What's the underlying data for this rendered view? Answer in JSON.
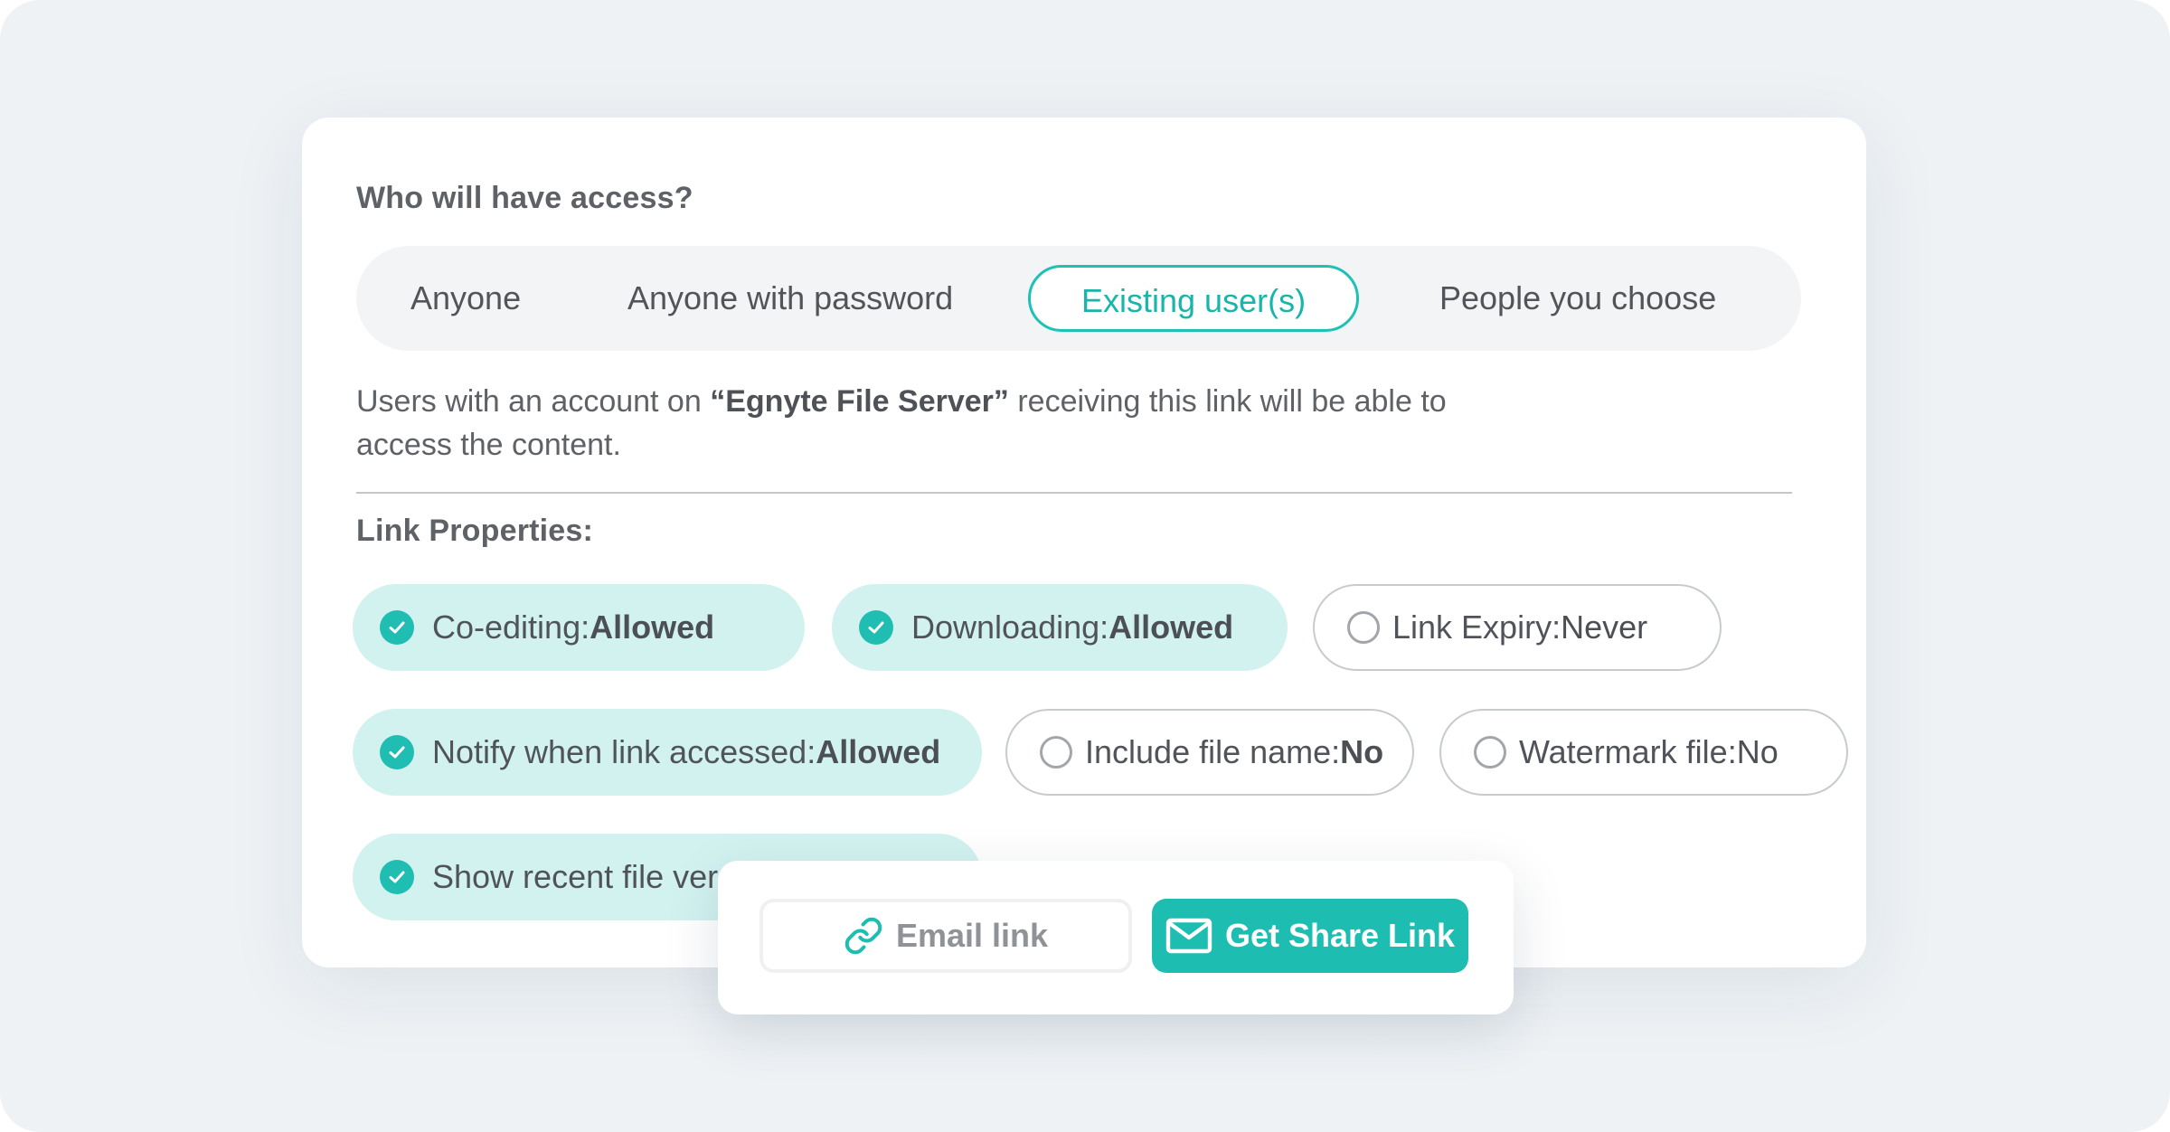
{
  "colors": {
    "accent": "#1ebdb2",
    "checked_pill_background": "#d2f2f0",
    "page_background": "#eef2f5"
  },
  "access": {
    "title": "Who will have access?",
    "options": [
      {
        "label": "Anyone",
        "selected": false
      },
      {
        "label": "Anyone with password",
        "selected": false
      },
      {
        "label": "Existing user(s)",
        "selected": true
      },
      {
        "label": "People you choose",
        "selected": false
      }
    ],
    "description": {
      "prefix": "Users with an account on ",
      "server_name": "“Egnyte File Server”",
      "suffix": " receiving this link will be able to access the content."
    }
  },
  "link_properties": {
    "title": "Link Properties:",
    "items": [
      {
        "label": "Co-editing: ",
        "value": "Allowed",
        "checked": true
      },
      {
        "label": "Downloading: ",
        "value": "Allowed",
        "checked": true
      },
      {
        "label": "Link Expiry: ",
        "value": "Never",
        "checked": false
      },
      {
        "label": "Notify when link accessed: ",
        "value": "Allowed",
        "checked": true
      },
      {
        "label": "Include file name: ",
        "value": "No",
        "checked": false
      },
      {
        "label": "Watermark file: ",
        "value": "No",
        "checked": false
      },
      {
        "label": "Show recent file ver",
        "checked": true
      }
    ]
  },
  "actions": {
    "email_label": "Email link",
    "email_icon": "link-icon",
    "share_label": "Get Share Link",
    "share_icon": "envelope-icon"
  }
}
